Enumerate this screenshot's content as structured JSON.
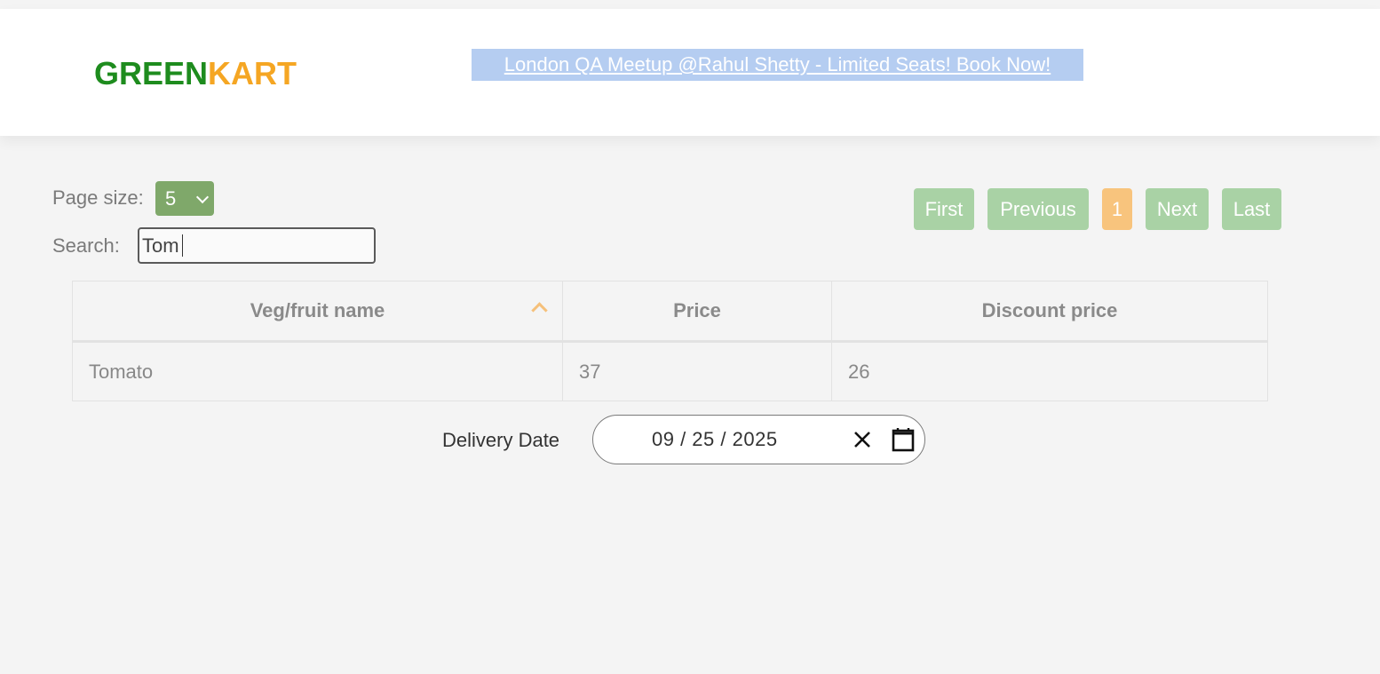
{
  "header": {
    "brand_part1": "GREEN",
    "brand_part2": "KART",
    "banner_link": "London QA Meetup @Rahul Shetty - Limited Seats! Book Now!"
  },
  "controls": {
    "page_size_label": "Page size:",
    "page_size_value": "5",
    "search_label": "Search:",
    "search_value": "Tom"
  },
  "pagination": {
    "first": "First",
    "previous": "Previous",
    "current_page": "1",
    "next": "Next",
    "last": "Last"
  },
  "table": {
    "columns": [
      "Veg/fruit name",
      "Price",
      "Discount price"
    ],
    "rows": [
      [
        "Tomato",
        "37",
        "26"
      ]
    ],
    "sort_column": "Veg/fruit name",
    "sort_direction": "ascending"
  },
  "delivery": {
    "label": "Delivery Date",
    "date_value": "09 / 25 / 2025"
  },
  "colors": {
    "brand_green": "#1e8c1e",
    "brand_orange": "#f5a623",
    "banner_bg": "#b5cdf1",
    "page_size_bg": "#7fa86a",
    "pager_btn": "#a9d2a5",
    "pager_active": "#f8c47d"
  },
  "icons": {
    "select_chevron": "chevron-down-icon",
    "sort": "sort-ascending-icon",
    "clear": "close-icon",
    "calendar": "calendar-icon"
  }
}
